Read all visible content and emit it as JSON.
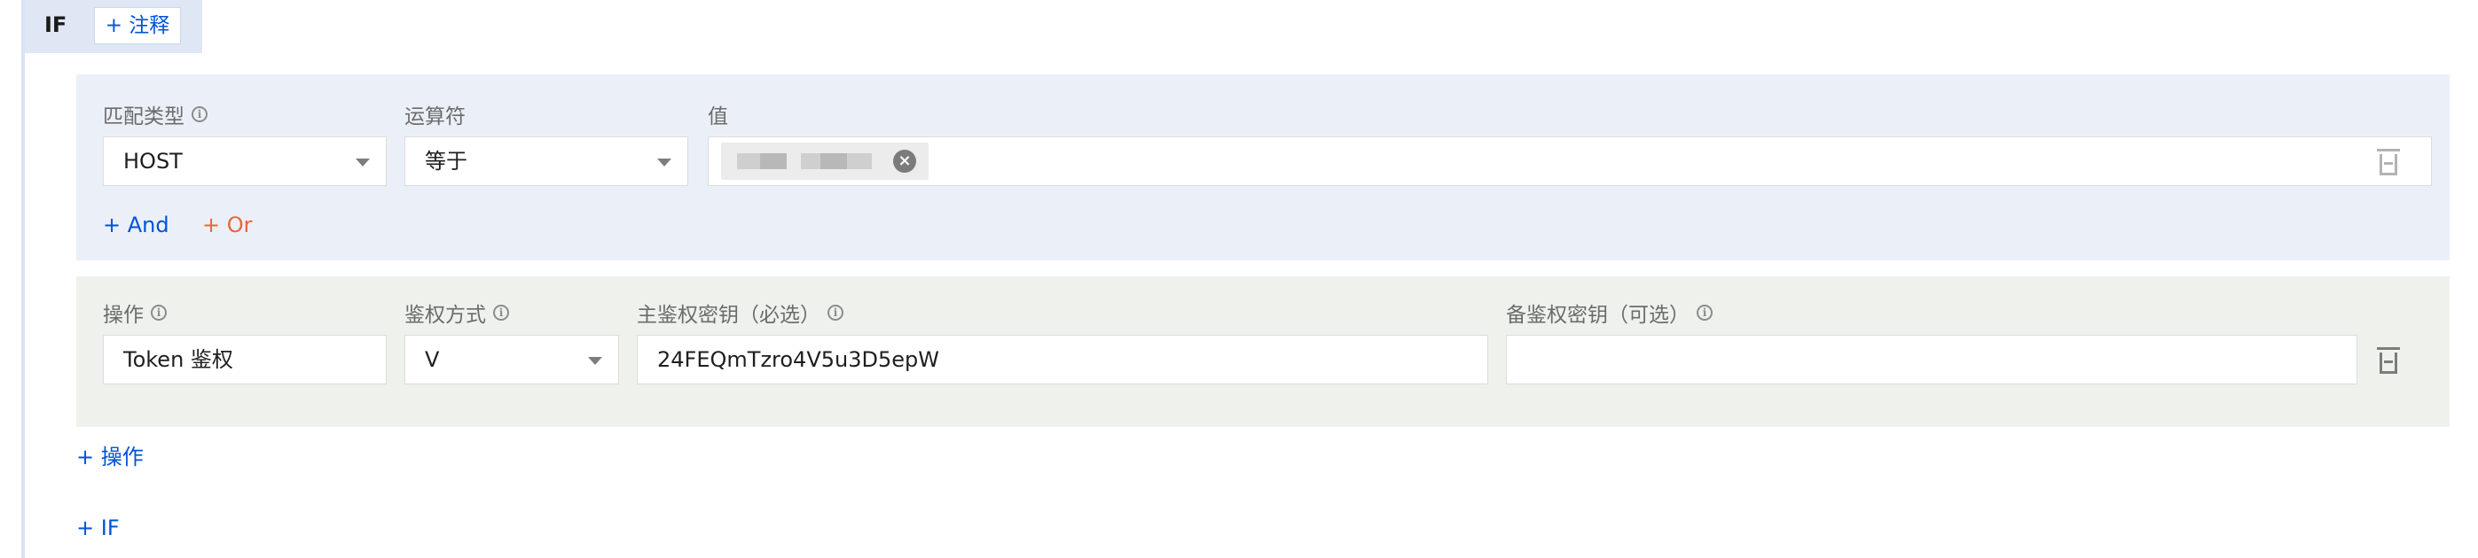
{
  "rule": {
    "if_label": "IF",
    "add_note": "+ 注释"
  },
  "condition": {
    "labels": {
      "match_type": "匹配类型",
      "operator": "运算符",
      "value": "值"
    },
    "match_type_value": "HOST",
    "operator_value": "等于",
    "add_and": "+ And",
    "add_or": "+ Or"
  },
  "action": {
    "labels": {
      "operation": "操作",
      "auth_method": "鉴权方式",
      "primary_key": "主鉴权密钥（必选）",
      "backup_key": "备鉴权密钥（可选）"
    },
    "operation_value": "Token 鉴权",
    "auth_method_value": "V",
    "primary_key_value": "24FEQmTzro4V5u3D5epW",
    "backup_key_value": ""
  },
  "footer": {
    "add_action": "+ 操作",
    "add_if": "+ IF"
  },
  "colors": {
    "accent": "#0052d9",
    "or_color": "#e8663c",
    "condition_bg": "#ebf0f8",
    "action_bg": "#eff2ec"
  },
  "icons": [
    "info-icon",
    "chevron-down-icon",
    "close-circle-icon",
    "trash-icon"
  ]
}
